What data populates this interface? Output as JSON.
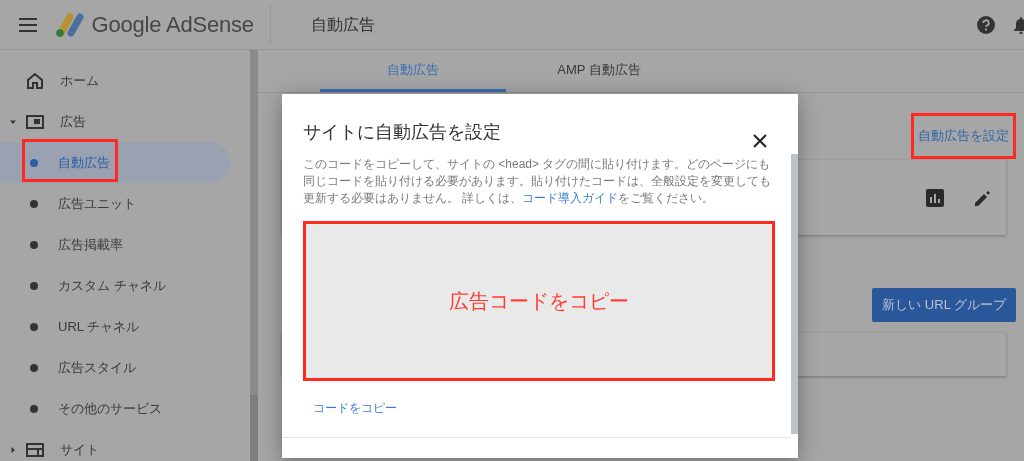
{
  "header": {
    "product": "Google AdSense",
    "page_title": "自動広告"
  },
  "sidebar": {
    "items": [
      {
        "kind": "link",
        "label": "ホーム",
        "selected": false
      },
      {
        "kind": "group",
        "label": "広告",
        "expanded": true,
        "children": [
          {
            "kind": "sub",
            "label": "自動広告",
            "selected": true,
            "highlighted": true
          },
          {
            "kind": "sub",
            "label": "広告ユニット",
            "selected": false,
            "highlighted": false
          },
          {
            "kind": "sub",
            "label": "広告掲載率",
            "selected": false,
            "highlighted": false
          },
          {
            "kind": "sub",
            "label": "カスタム チャネル",
            "selected": false,
            "highlighted": false
          },
          {
            "kind": "sub",
            "label": "URL チャネル",
            "selected": false,
            "highlighted": false
          },
          {
            "kind": "sub",
            "label": "広告スタイル",
            "selected": false,
            "highlighted": false
          },
          {
            "kind": "sub",
            "label": "その他のサービス",
            "selected": false,
            "highlighted": false
          }
        ]
      },
      {
        "kind": "group",
        "label": "サイト",
        "expanded": false
      }
    ]
  },
  "tabs": [
    {
      "label": "自動広告",
      "selected": true
    },
    {
      "label": "AMP 自動広告",
      "selected": false
    }
  ],
  "setup_link": {
    "label": "自動広告を設定",
    "highlighted": true
  },
  "new_group_button": {
    "label": "新しい URL グループ"
  },
  "dialog": {
    "title": "サイトに自動広告を設定",
    "description_before": "このコードをコピーして、サイトの <head> タグの間に貼り付けます。どのページにも同じコードを貼り付ける必要があります。貼り付けたコードは、全般設定を変更しても更新する必要はありません。 詳しくは、",
    "description_link": "コード導入ガイド",
    "description_after": "をご覧ください。",
    "code_area": {
      "label": "広告コードをコピー",
      "highlighted": true
    },
    "copy_link": "コードをコピー"
  }
}
